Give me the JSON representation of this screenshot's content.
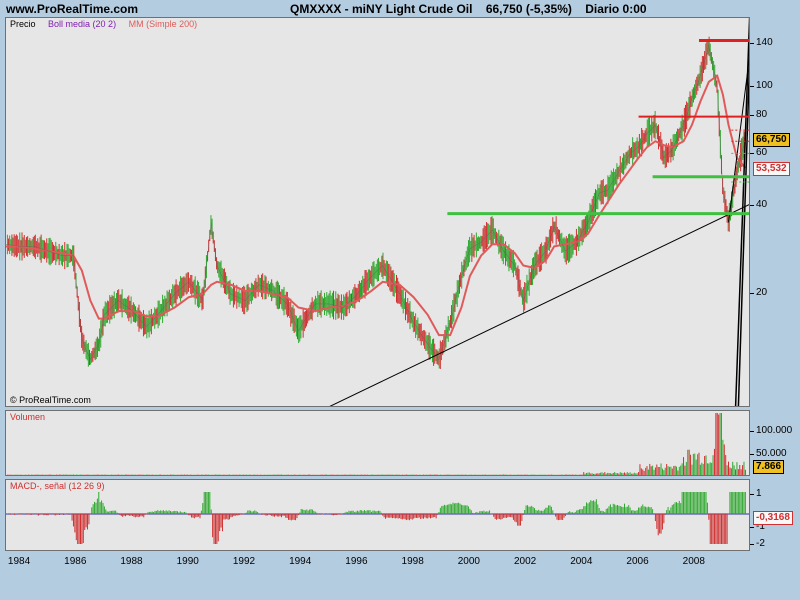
{
  "header": {
    "site": "www.ProRealTime.com",
    "symbol": "QMXXXX - miNY Light Crude Oil",
    "last": "66,750 (-5,35%)",
    "period": "Diario 0:00"
  },
  "legend": {
    "price": "Precio",
    "bollinger": "Boll media (20 2)",
    "sma": "MM (Simple 200)"
  },
  "copyright": "© ProRealTime.com",
  "volume_label": "Volumen",
  "macd_label": "MACD-, señal (12 26 9)",
  "colors": {
    "background": "#b4cce0",
    "panel": "#e6e6e6",
    "bars_up": "#2fa82f",
    "bars_down": "#d03030",
    "bollinger": "#a020c0",
    "sma": "#e05a5a",
    "resistance": "#e02020",
    "support": "#40c040",
    "trendline": "#000000",
    "last_badge": "#f0c020",
    "volume_badge": "#f0c020",
    "macd_badge": "#f8f8f8"
  },
  "price_scale": {
    "ticks": [
      "140",
      "100",
      "80",
      "60",
      "40",
      "20"
    ],
    "last_price": "66,750",
    "sma_value": "53,532"
  },
  "volume_scale": {
    "ticks": [
      "100.000",
      "50.000"
    ],
    "last_volume": "7.866"
  },
  "macd_scale": {
    "ticks": [
      "1",
      "-1",
      "-2"
    ],
    "last_macd": "-0,3168"
  },
  "x_axis": {
    "labels": [
      "1984",
      "1986",
      "1988",
      "1990",
      "1992",
      "1994",
      "1996",
      "1998",
      "2000",
      "2002",
      "2004",
      "2006",
      "2008"
    ]
  },
  "chart_data": {
    "type": "line",
    "title": "QMXXXX - miNY Light Crude Oil",
    "scale": "log",
    "ylim": [
      9,
      160
    ],
    "xlim": [
      1983.5,
      2010.0
    ],
    "x": [
      1983.5,
      1984.0,
      1984.5,
      1985.0,
      1985.5,
      1985.9,
      1986.2,
      1986.5,
      1986.8,
      1987.0,
      1987.5,
      1988.0,
      1988.5,
      1988.9,
      1989.5,
      1990.0,
      1990.5,
      1990.8,
      1991.0,
      1991.5,
      1992.0,
      1992.5,
      1993.0,
      1993.5,
      1993.9,
      1994.5,
      1995.0,
      1995.5,
      1996.0,
      1996.5,
      1996.9,
      1997.5,
      1998.0,
      1998.5,
      1998.9,
      1999.3,
      1999.7,
      2000.0,
      2000.4,
      2000.8,
      2001.2,
      2001.6,
      2001.9,
      2002.3,
      2002.7,
      2003.0,
      2003.4,
      2003.8,
      2004.2,
      2004.6,
      2004.9,
      2005.3,
      2005.7,
      2006.0,
      2006.3,
      2006.6,
      2006.9,
      2007.2,
      2007.6,
      2007.9,
      2008.2,
      2008.5,
      2008.8,
      2009.0,
      2009.2,
      2009.5,
      2009.7,
      2009.8
    ],
    "series": [
      {
        "name": "Precio",
        "values": [
          29.5,
          29.0,
          29.0,
          28.0,
          27.0,
          27.0,
          14.0,
          12.0,
          13.5,
          17.0,
          19.0,
          17.5,
          15.5,
          17.0,
          20.0,
          22.0,
          19.0,
          35.0,
          25.0,
          20.0,
          19.0,
          21.5,
          20.5,
          18.5,
          15.0,
          18.5,
          18.5,
          18.0,
          20.0,
          23.0,
          25.0,
          20.0,
          16.0,
          13.5,
          12.0,
          16.0,
          23.0,
          28.5,
          30.0,
          33.0,
          28.0,
          25.0,
          19.0,
          25.0,
          28.0,
          34.0,
          28.0,
          30.0,
          35.0,
          44.0,
          45.0,
          52.0,
          60.0,
          63.0,
          70.0,
          75.0,
          58.0,
          62.0,
          75.0,
          92.0,
          110.0,
          140.0,
          100.0,
          45.0,
          35.0,
          52.0,
          62.0,
          66.75
        ]
      },
      {
        "name": "MM (Simple 200)",
        "values": [
          29.0,
          29.0,
          28.5,
          28.0,
          27.5,
          27.0,
          24.0,
          19.0,
          16.5,
          16.5,
          17.5,
          17.5,
          16.8,
          16.8,
          18.0,
          19.5,
          20.0,
          21.5,
          22.0,
          21.5,
          20.5,
          20.5,
          20.0,
          19.5,
          18.0,
          17.5,
          18.0,
          18.2,
          19.0,
          20.5,
          22.0,
          21.5,
          19.5,
          17.0,
          14.5,
          14.5,
          18.0,
          23.0,
          27.0,
          29.5,
          29.5,
          27.5,
          25.0,
          24.5,
          26.0,
          29.0,
          29.5,
          30.0,
          32.0,
          37.0,
          41.0,
          47.0,
          53.0,
          58.0,
          63.0,
          66.0,
          64.0,
          63.0,
          66.0,
          75.0,
          90.0,
          105.0,
          110.0,
          95.0,
          75.0,
          58.0,
          55.0,
          53.532
        ]
      }
    ],
    "horizontal_levels": {
      "resistance": [
        145,
        80
      ],
      "support": [
        50,
        37.5
      ]
    }
  }
}
